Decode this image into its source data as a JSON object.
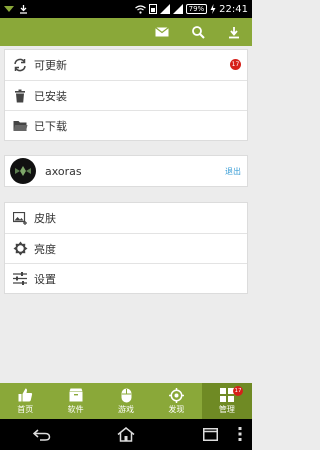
{
  "status_bar": {
    "battery": "79%",
    "time": "22:41"
  },
  "menu": {
    "update": {
      "label": "可更新",
      "badge": "17"
    },
    "installed": {
      "label": "已安装"
    },
    "downloaded": {
      "label": "已下载"
    }
  },
  "user": {
    "name": "axoras",
    "logout": "退出"
  },
  "settings": {
    "skin": "皮肤",
    "brightness": "亮度",
    "settings": "设置"
  },
  "bottom_nav": {
    "items": [
      {
        "label": "首页",
        "icon": "thumbs-up-icon"
      },
      {
        "label": "软件",
        "icon": "box-icon"
      },
      {
        "label": "游戏",
        "icon": "mouse-icon"
      },
      {
        "label": "发现",
        "icon": "target-icon"
      },
      {
        "label": "管理",
        "icon": "grid-icon",
        "badge": "17"
      }
    ]
  },
  "colors": {
    "accent": "#8aa839",
    "accent_active": "#6f8a24",
    "badge": "#d6201a",
    "link": "#3b9ed6"
  }
}
